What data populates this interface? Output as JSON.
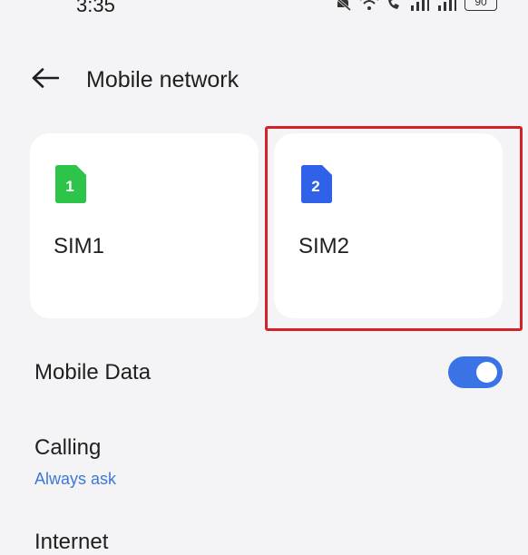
{
  "status_bar": {
    "time": "3:35",
    "battery": "90",
    "icons": [
      "mute-icon",
      "wifi-icon",
      "volte-call-icon",
      "signal-icon",
      "signal-icon"
    ]
  },
  "header": {
    "title": "Mobile network",
    "back_icon": "arrow-left-icon"
  },
  "sims": [
    {
      "label": "SIM1",
      "number": "1",
      "color": "#2ec44a"
    },
    {
      "label": "SIM2",
      "number": "2",
      "color": "#2f62e8"
    }
  ],
  "settings": {
    "mobile_data": {
      "label": "Mobile Data",
      "enabled": true
    },
    "calling": {
      "label": "Calling",
      "value": "Always ask"
    },
    "internet": {
      "label": "Internet"
    }
  },
  "colors": {
    "accent": "#3a73e6",
    "highlight": "#d42228",
    "background": "#f4f4f6"
  }
}
